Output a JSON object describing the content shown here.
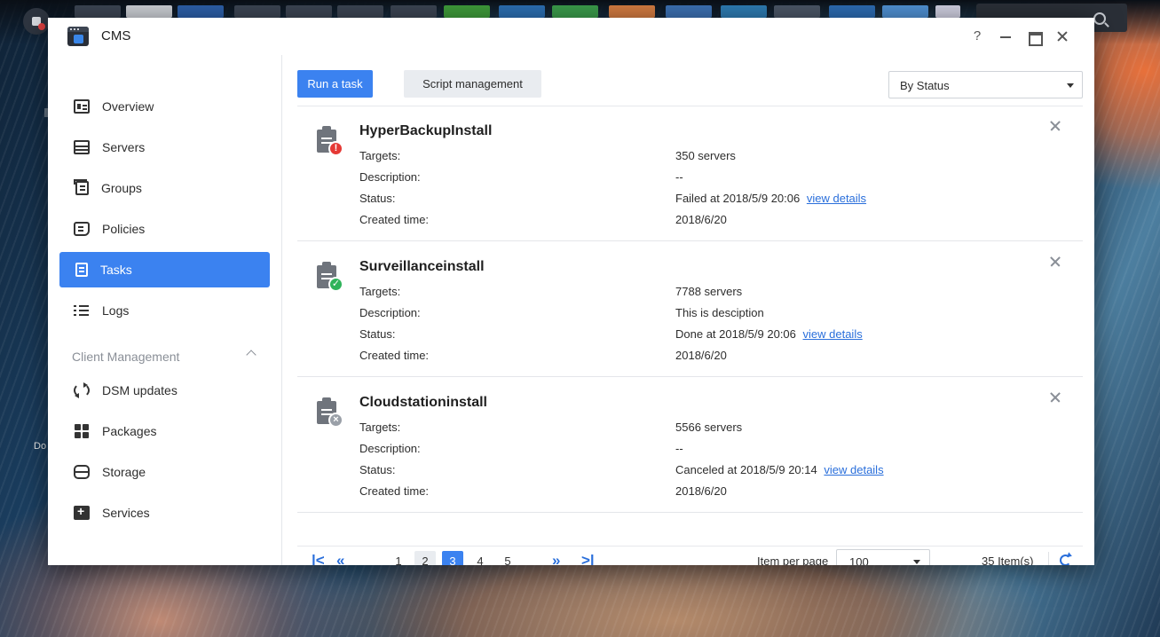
{
  "desktop": {
    "label": "Do"
  },
  "window": {
    "title": "CMS",
    "help": "?"
  },
  "sidebar": {
    "items": [
      {
        "label": "Overview",
        "icon": "overview-icon"
      },
      {
        "label": "Servers",
        "icon": "servers-icon"
      },
      {
        "label": "Groups",
        "icon": "groups-icon"
      },
      {
        "label": "Policies",
        "icon": "policies-icon"
      },
      {
        "label": "Tasks",
        "icon": "tasks-icon",
        "active": true
      },
      {
        "label": "Logs",
        "icon": "logs-icon"
      }
    ],
    "section_label": "Client Management",
    "section_items": [
      {
        "label": "DSM updates",
        "icon": "refresh-icon"
      },
      {
        "label": "Packages",
        "icon": "packages-icon"
      },
      {
        "label": "Storage",
        "icon": "storage-icon"
      },
      {
        "label": "Services",
        "icon": "services-icon"
      }
    ]
  },
  "toolbar": {
    "run_task": "Run a task",
    "script_management": "Script management",
    "filter_value": "By Status"
  },
  "tasks": [
    {
      "name": "HyperBackupInstall",
      "status_type": "failed",
      "badge": "!",
      "labels": {
        "targets": "Targets:",
        "description": "Description:",
        "status": "Status:",
        "created": "Created time:"
      },
      "targets": "350 servers",
      "description": "--",
      "status": "Failed at 2018/5/9 20:06",
      "link": "view details",
      "created": "2018/6/20"
    },
    {
      "name": "Surveillanceinstall",
      "status_type": "done",
      "badge": "✓",
      "labels": {
        "targets": "Targets:",
        "description": "Description:",
        "status": "Status:",
        "created": "Created time:"
      },
      "targets": "7788 servers",
      "description": "This is desciption",
      "status": "Done at 2018/5/9 20:06",
      "link": "view details",
      "created": "2018/6/20"
    },
    {
      "name": "Cloudstationinstall",
      "status_type": "canceled",
      "badge": "×",
      "labels": {
        "targets": "Targets:",
        "description": "Description:",
        "status": "Status:",
        "created": "Created time:"
      },
      "targets": "5566 servers",
      "description": "--",
      "status": "Canceled at 2018/5/9 20:14",
      "link": "view details",
      "created": "2018/6/20"
    }
  ],
  "pager": {
    "first": "|<",
    "prev": "«",
    "pages": [
      "1",
      "2",
      "3",
      "4",
      "5"
    ],
    "current_page": "3",
    "next": "»",
    "last": ">|",
    "per_page_label": "Item per page",
    "per_page_value": "100",
    "count": "35 Item(s)"
  },
  "colors": {
    "accent": "#3b82f0",
    "link": "#2a6fdb",
    "error": "#e53935",
    "success": "#2fb35a",
    "canceled": "#9aa0a8"
  }
}
